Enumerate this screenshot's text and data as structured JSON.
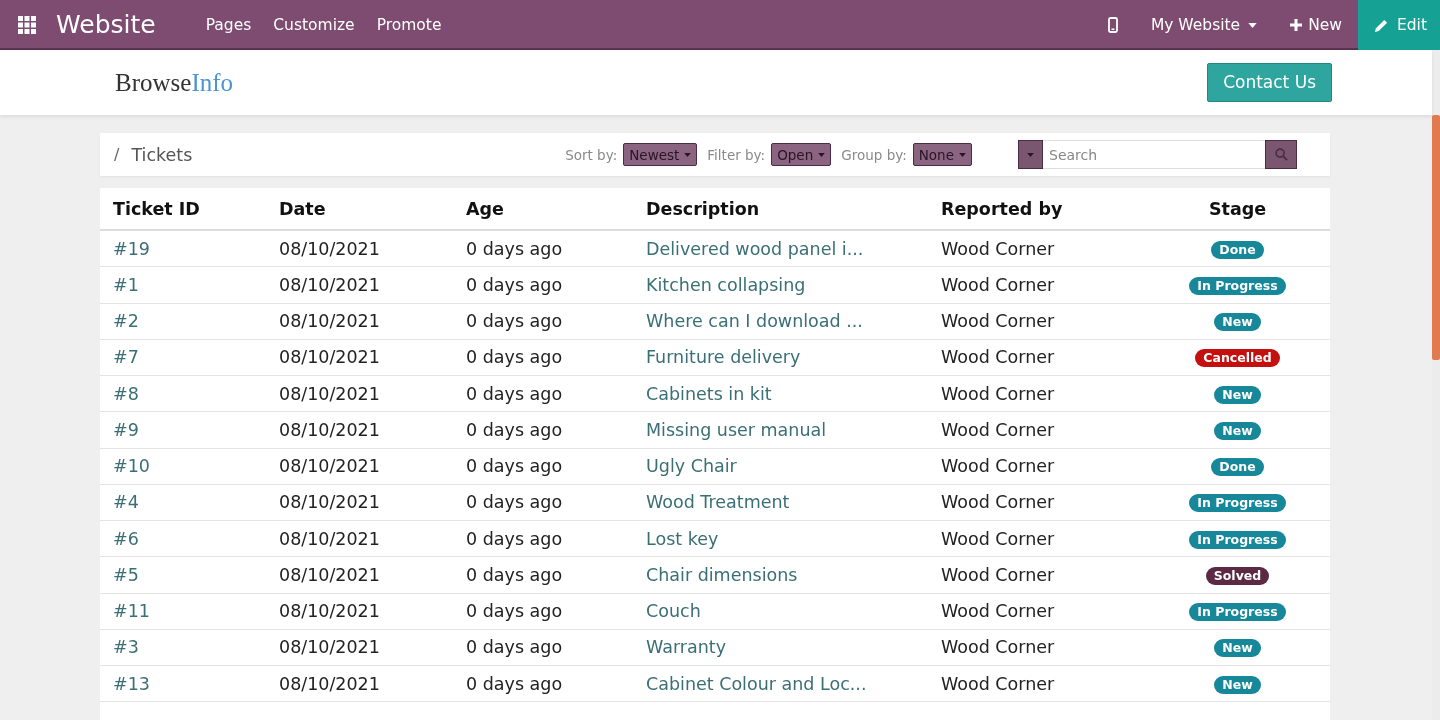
{
  "navbar": {
    "app_title": "Website",
    "menu": [
      "Pages",
      "Customize",
      "Promote"
    ],
    "website_switcher": "My Website",
    "new_button": "New",
    "edit_button": "Edit"
  },
  "header": {
    "logo": {
      "part_1": "Browse",
      "part_2": "Info"
    },
    "contact_button": "Contact Us"
  },
  "toolbar": {
    "breadcrumb_separator": "/",
    "breadcrumb": "Tickets",
    "dropdowns": [
      {
        "label": "Sort by:",
        "value": "Newest"
      },
      {
        "label": "Filter by:",
        "value": "Open"
      },
      {
        "label": "Group by:",
        "value": "None"
      }
    ],
    "search": {
      "placeholder": "Search"
    }
  },
  "table": {
    "columns": [
      "Ticket ID",
      "Date",
      "Age",
      "Description",
      "Reported by",
      "Stage"
    ],
    "rows": [
      {
        "ticket_id": "#19",
        "date": "08/10/2021",
        "age": "0 days ago",
        "description": "Delivered wood panel i...",
        "reported_by": "Wood Corner",
        "stage": {
          "label": "Done",
          "color": "#17879a"
        }
      },
      {
        "ticket_id": "#1",
        "date": "08/10/2021",
        "age": "0 days ago",
        "description": "Kitchen collapsing",
        "reported_by": "Wood Corner",
        "stage": {
          "label": "In Progress",
          "color": "#17879a"
        }
      },
      {
        "ticket_id": "#2",
        "date": "08/10/2021",
        "age": "0 days ago",
        "description": "Where can I download ...",
        "reported_by": "Wood Corner",
        "stage": {
          "label": "New",
          "color": "#17879a"
        }
      },
      {
        "ticket_id": "#7",
        "date": "08/10/2021",
        "age": "0 days ago",
        "description": "Furniture delivery",
        "reported_by": "Wood Corner",
        "stage": {
          "label": "Cancelled",
          "color": "#c4100f"
        }
      },
      {
        "ticket_id": "#8",
        "date": "08/10/2021",
        "age": "0 days ago",
        "description": "Cabinets in kit",
        "reported_by": "Wood Corner",
        "stage": {
          "label": "New",
          "color": "#17879a"
        }
      },
      {
        "ticket_id": "#9",
        "date": "08/10/2021",
        "age": "0 days ago",
        "description": "Missing user manual",
        "reported_by": "Wood Corner",
        "stage": {
          "label": "New",
          "color": "#17879a"
        }
      },
      {
        "ticket_id": "#10",
        "date": "08/10/2021",
        "age": "0 days ago",
        "description": "Ugly Chair",
        "reported_by": "Wood Corner",
        "stage": {
          "label": "Done",
          "color": "#17879a"
        }
      },
      {
        "ticket_id": "#4",
        "date": "08/10/2021",
        "age": "0 days ago",
        "description": "Wood Treatment",
        "reported_by": "Wood Corner",
        "stage": {
          "label": "In Progress",
          "color": "#17879a"
        }
      },
      {
        "ticket_id": "#6",
        "date": "08/10/2021",
        "age": "0 days ago",
        "description": "Lost key",
        "reported_by": "Wood Corner",
        "stage": {
          "label": "In Progress",
          "color": "#17879a"
        }
      },
      {
        "ticket_id": "#5",
        "date": "08/10/2021",
        "age": "0 days ago",
        "description": "Chair dimensions",
        "reported_by": "Wood Corner",
        "stage": {
          "label": "Solved",
          "color": "#5c2a45"
        }
      },
      {
        "ticket_id": "#11",
        "date": "08/10/2021",
        "age": "0 days ago",
        "description": "Couch",
        "reported_by": "Wood Corner",
        "stage": {
          "label": "In Progress",
          "color": "#17879a"
        }
      },
      {
        "ticket_id": "#3",
        "date": "08/10/2021",
        "age": "0 days ago",
        "description": "Warranty",
        "reported_by": "Wood Corner",
        "stage": {
          "label": "New",
          "color": "#17879a"
        }
      },
      {
        "ticket_id": "#13",
        "date": "08/10/2021",
        "age": "0 days ago",
        "description": "Cabinet Colour and Loc...",
        "reported_by": "Wood Corner",
        "stage": {
          "label": "New",
          "color": "#17879a"
        }
      }
    ]
  }
}
